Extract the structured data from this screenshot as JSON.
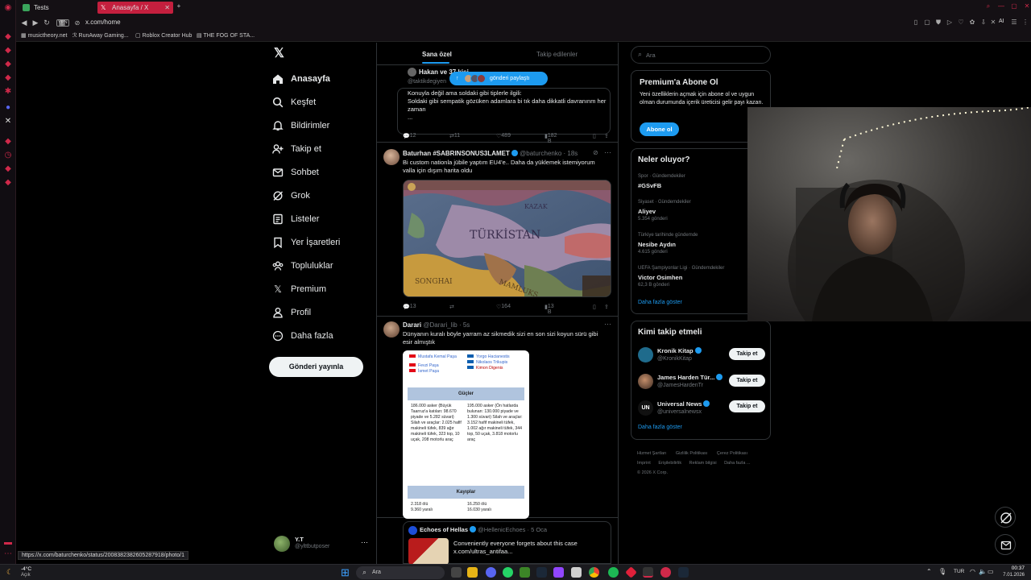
{
  "browser": {
    "tabs": [
      {
        "label": "Tests",
        "color": "#3aa55c"
      },
      {
        "label": "Anasayfa / X",
        "color": "#ffffff"
      }
    ],
    "vpn_label": "VPN",
    "url": "x.com/home",
    "bookmarks": [
      "musictheory.net",
      "RunAway Gaming...",
      "Roblox Creator Hub",
      "THE FOG OF STA..."
    ],
    "ai_label": "AI"
  },
  "sidebar": {
    "items": [
      {
        "label": "Anasayfa",
        "icon": "home-icon"
      },
      {
        "label": "Keşfet",
        "icon": "search-icon"
      },
      {
        "label": "Bildirimler",
        "icon": "bell-icon"
      },
      {
        "label": "Takip et",
        "icon": "add-user-icon"
      },
      {
        "label": "Sohbet",
        "icon": "mail-icon"
      },
      {
        "label": "Grok",
        "icon": "grok-icon"
      },
      {
        "label": "Listeler",
        "icon": "list-icon"
      },
      {
        "label": "Yer İşaretleri",
        "icon": "bookmark-icon"
      },
      {
        "label": "Topluluklar",
        "icon": "people-icon"
      },
      {
        "label": "Premium",
        "icon": "x-logo-icon"
      },
      {
        "label": "Profil",
        "icon": "person-icon"
      },
      {
        "label": "Daha fazla",
        "icon": "more-circle-icon"
      }
    ],
    "post_button": "Gönderi yayınla",
    "profile": {
      "name": "Y.T",
      "handle": "@ylttbutposer"
    }
  },
  "feed": {
    "tabs": [
      "Sana özel",
      "Takip edilenler"
    ],
    "new_posts_pill": "gönderi paylaştı",
    "tweets": [
      {
        "name": "Hakan ve 37 kişi",
        "handle": "@taktikdegiyen",
        "text": "Konuyla değil ama soldaki gibi tiplerle ilgili:\nSoldaki gibi sempatik gözüken adamlara bi tık daha dikkatli davranınm her zaman\n...",
        "actions": {
          "replies": "12",
          "reposts": "11",
          "likes": "489",
          "views": "182 B"
        }
      },
      {
        "name": "Baturhan #SABRINSONUS3LAMET",
        "handle": "@baturchenko · 18s",
        "text": "Bi custom nationla jübile yaptım EU4'e.. Daha da yüklemek istemiyorum valla için dışım harita oldu",
        "map_labels": [
          "TÜRKİSTAN",
          "KAZAK",
          "SONGHAI",
          "MAMLUKS"
        ],
        "actions": {
          "replies": "13",
          "reposts": "",
          "likes": "164",
          "views": "13 B"
        }
      },
      {
        "name": "Darari",
        "handle": "@Darari_lib · 5s",
        "text": "Dünyanın kuralı böyle yarram az sikmedik sizi en son sizi koyun sürü gibi esir almıştık",
        "infobox": {
          "left_commanders": [
            "Mustafa Kemal Paşa",
            "Fevzi Paşa",
            "İsmet Paşa"
          ],
          "right_commanders": [
            "Yorgo Hacianestis",
            "Nikolaos Trikupis",
            "Kimon Digenis"
          ],
          "strength_header": "Güçler",
          "left_strength": "186.000 asker (Büyük Taarruz'a katılan: 98.670 piyade ve 5.282 süvari) Silah ve araçlar: 2.025 hafif makineli tüfek, 839 ağır makineli tüfek, 323 top, 10 uçak, 208 motorlu araç",
          "right_strength": "195.000 asker (Ön hatlarda bulunan: 130.000 piyade ve 1.300 süvari) Silah ve araçlar: 3.152 hafif makineli tüfek, 1.002 ağır makineli tüfek, 344 top, 50 uçak, 3.818 motorlu araç",
          "losses_header": "Kayıplar",
          "left_losses": [
            "2.318 ölü",
            "9.360 yaralı"
          ],
          "right_losses": [
            "16.250 ölü",
            "16.030 yaralı"
          ]
        }
      },
      {
        "name": "Echoes of Hellas",
        "handle": "@HellenicEchoes · 5 Oca",
        "text": "Conveniently everyone forgets about this case x.com/ultras_antifaa..."
      }
    ]
  },
  "right": {
    "search_placeholder": "Ara",
    "premium": {
      "title": "Premium'a Abone Ol",
      "body": "Yeni özelliklerin açmak için abone ol ve uygun olman durumunda içerik üreticisi gelir payı kazan.",
      "button": "Abone ol"
    },
    "trends_title": "Neler oluyor?",
    "trends": [
      {
        "meta": "Spor · Gündemdekiler",
        "name": "#GSvFB",
        "count": ""
      },
      {
        "meta": "Siyaset · Gündemdekiler",
        "name": "Aliyev",
        "count": "5.354 gönderi"
      },
      {
        "meta": "Türkiye tarihinde gündemde",
        "name": "Nesibe Aydın",
        "count": "4.615 gönderi"
      },
      {
        "meta": "UEFA Şampiyonlar Ligi · Gündemdekiler",
        "name": "Victor Osimhen",
        "count": "62,3 B gönderi"
      }
    ],
    "trends_more": "Daha fazla göster",
    "who_title": "Kimi takip etmeli",
    "who": [
      {
        "name": "Kronik Kitap",
        "handle": "@KronikKitap",
        "button": "Takip et"
      },
      {
        "name": "James Harden Tür...",
        "handle": "@JamesHardenTr",
        "button": "Takip et"
      },
      {
        "name": "Universal News",
        "handle": "@universalnewsx",
        "button": "Takip et"
      }
    ],
    "who_more": "Daha fazla göster",
    "footer": [
      "Hizmet Şartları",
      "Gizlilik Politikası",
      "Çerez Politikası",
      "Imprint",
      "Erişilebilirlik",
      "Reklam bilgisi",
      "Daha fazla ...",
      "© 2026 X Corp."
    ]
  },
  "status_url": "https://x.com/baturchenko/status/2008382382605287918/photo/1",
  "taskbar": {
    "weather_temp": "-4°C",
    "weather_desc": "Açık",
    "search_placeholder": "Ara",
    "lang": "TUR",
    "time": "00:37",
    "date": "7.01.2026"
  }
}
